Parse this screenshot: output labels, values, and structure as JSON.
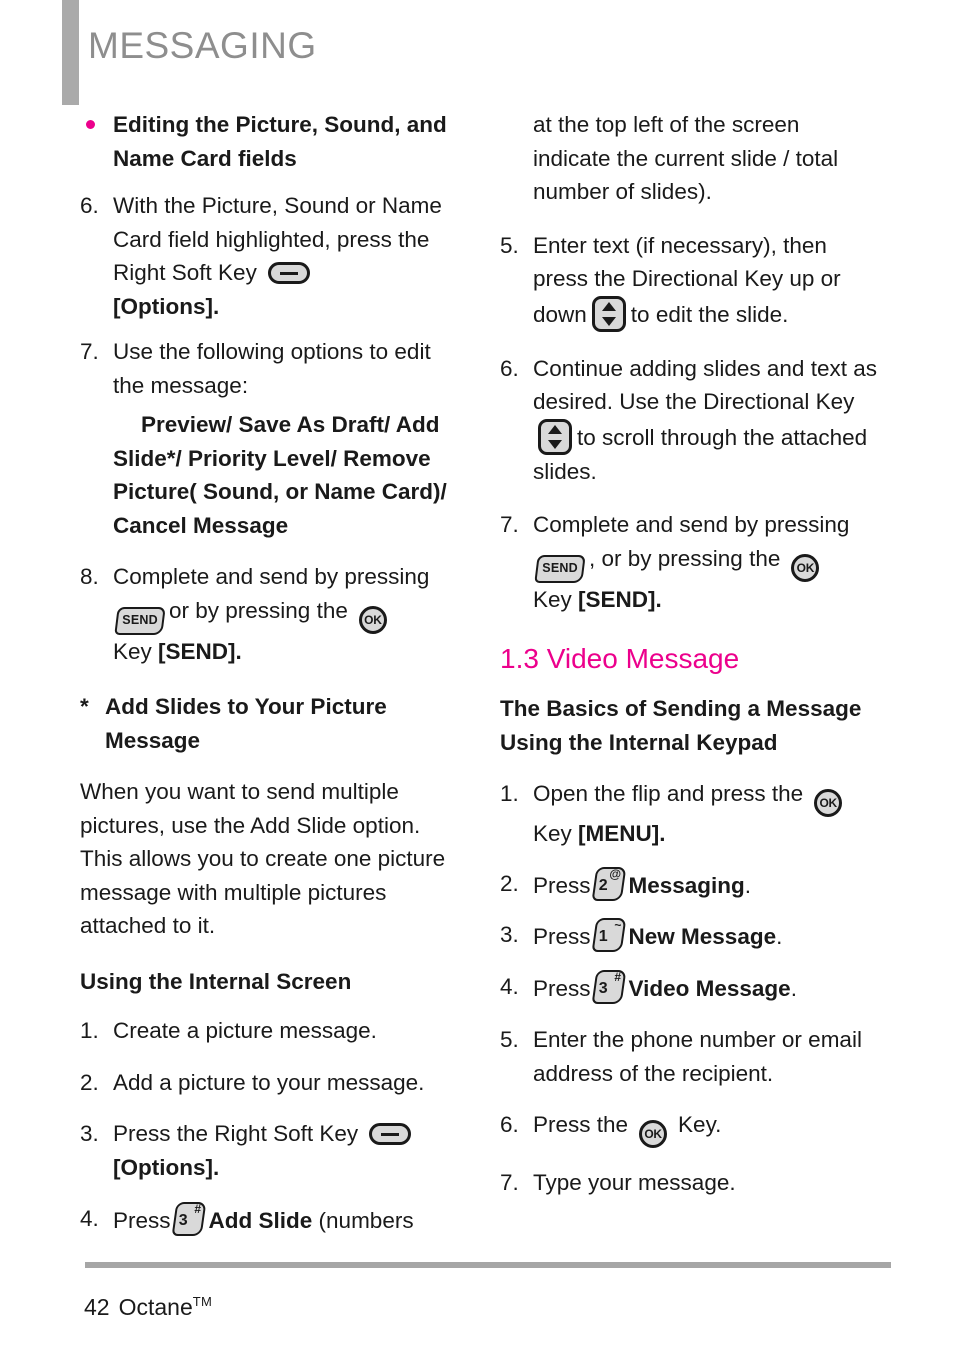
{
  "header": {
    "title": "MESSAGING",
    "bar_color": "#aaaaaa",
    "title_color": "#8e8e8e"
  },
  "accent_color": "#ec008c",
  "icons": {
    "soft_key": "right-soft-key-icon",
    "ok_key": "OK",
    "send_key": "SEND",
    "dir_key": "directional-key-icon",
    "key1_num": "1",
    "key1_sup": "~",
    "key2_num": "2",
    "key2_sup": "@",
    "key3_num": "3",
    "key3_sup": "#"
  },
  "left_column": {
    "bullet_heading": "Editing the Picture, Sound, and Name Card fields",
    "item6_num": "6.",
    "item6_a": "With the Picture, Sound or Name Card field highlighted, press the Right Soft Key",
    "item6_b": "[Options].",
    "item7_num": "7.",
    "item7_a": "Use the following options to edit the message:",
    "item7_options": "Preview/ Save As Draft/ Add Slide*/ Priority Level/ Remove Picture( Sound, or Name Card)/ Cancel Message",
    "item8_num": "8.",
    "item8_a": "Complete and send by pressing",
    "item8_b": "or by pressing the",
    "item8_c": "Key",
    "item8_d": "[SEND].",
    "star_marker": "*",
    "star_heading": "Add Slides to Your Picture Message",
    "paragraph": "When you want to send multiple pictures, use the Add Slide option. This allows you to create one picture message with multiple pictures attached to it.",
    "sub_heading": "Using the Internal Screen",
    "step1_num": "1.",
    "step1": "Create a picture message.",
    "step2_num": "2.",
    "step2": "Add a picture to your message.",
    "step3_num": "3.",
    "step3_a": "Press the Right Soft Key",
    "step3_b": "[Options].",
    "step4_num": "4.",
    "step4_a": "Press",
    "step4_b": "Add Slide",
    "step4_c": "(numbers"
  },
  "right_column": {
    "cont_paragraph": "at the top left of the screen indicate the current slide / total number of slides).",
    "item5_num": "5.",
    "item5_a": "Enter text (if necessary), then press the Directional Key up or down",
    "item5_b": "to edit the slide.",
    "item6_num": "6.",
    "item6_a": "Continue adding slides and text as desired. Use the Directional Key",
    "item6_b": "to scroll through the attached slides.",
    "item7_num": "7.",
    "item7_a": "Complete and send by pressing",
    "item7_b": ", or by pressing the",
    "item7_c": "Key",
    "item7_d": "[SEND].",
    "section_title": "1.3 Video Message",
    "basics_heading": "The Basics of Sending a Message Using the Internal Keypad",
    "step1_num": "1.",
    "step1_a": "Open the flip and press the",
    "step1_b": "Key",
    "step1_c": "[MENU].",
    "step2_num": "2.",
    "step2_a": "Press",
    "step2_b": "Messaging",
    "step2_c": ".",
    "step3_num": "3.",
    "step3_a": "Press",
    "step3_b": "New Message",
    "step3_c": ".",
    "step4_num": "4.",
    "step4_a": "Press",
    "step4_b": "Video Message",
    "step4_c": ".",
    "step5_num": "5.",
    "step5": "Enter the phone number or email address of the recipient.",
    "step6_num": "6.",
    "step6_a": "Press the",
    "step6_b": "Key.",
    "step7_num": "7.",
    "step7": "Type your message."
  },
  "footer": {
    "page_number": "42",
    "product": "Octane",
    "trademark": "TM"
  }
}
